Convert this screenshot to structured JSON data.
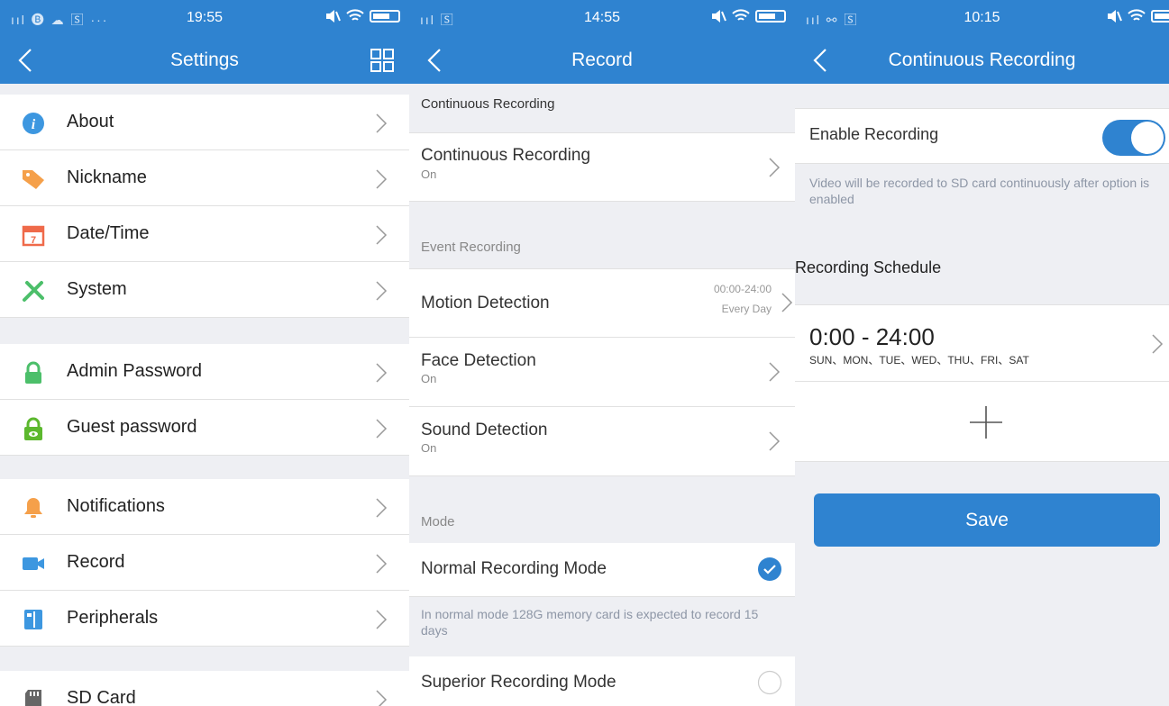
{
  "settings": {
    "status": {
      "left_icons": "ııl 🅑 ☁ 🅂 ···",
      "time": "19:55"
    },
    "title": "Settings",
    "groups": [
      [
        {
          "label": "About",
          "icon": "info-icon",
          "color": "#3d97e0"
        },
        {
          "label": "Nickname",
          "icon": "tag-icon",
          "color": "#f5a04a"
        },
        {
          "label": "Date/Time",
          "icon": "calendar-icon",
          "color": "#ef6a4a"
        },
        {
          "label": "System",
          "icon": "tools-icon",
          "color": "#4cbf6a"
        }
      ],
      [
        {
          "label": "Admin Password",
          "icon": "lock-icon",
          "color": "#4cbf6a"
        },
        {
          "label": "Guest password",
          "icon": "guest-lock-icon",
          "color": "#5cb82e"
        }
      ],
      [
        {
          "label": "Notifications",
          "icon": "bell-icon",
          "color": "#f5a04a"
        },
        {
          "label": "Record",
          "icon": "video-camera-icon",
          "color": "#3d97e0"
        },
        {
          "label": "Peripherals",
          "icon": "peripherals-icon",
          "color": "#3d97e0"
        }
      ],
      [
        {
          "label": "SD Card",
          "icon": "sd-card-icon",
          "color": "#666666"
        }
      ]
    ]
  },
  "record": {
    "status": {
      "left_icons": "ııl 🅂",
      "time": "14:55"
    },
    "title": "Record",
    "section_continuous": "Continuous Recording",
    "continuous": {
      "label": "Continuous Recording",
      "value": "On"
    },
    "section_event": "Event Recording",
    "motion": {
      "label": "Motion Detection",
      "time": "00:00-24:00",
      "days": "Every Day"
    },
    "face": {
      "label": "Face Detection",
      "value": "On"
    },
    "sound": {
      "label": "Sound Detection",
      "value": "On"
    },
    "section_mode": "Mode",
    "normal_mode": {
      "label": "Normal Recording Mode",
      "checked": true
    },
    "normal_note": "In normal mode 128G memory card is expected to record 15 days",
    "superior_mode": {
      "label": "Superior Recording Mode",
      "checked": false
    }
  },
  "continuous": {
    "status": {
      "left_icons": "ııl ⚯ 🅂",
      "time": "10:15"
    },
    "title": "Continuous Recording",
    "enable_label": "Enable Recording",
    "enabled": true,
    "enable_note": "Video will be recorded to SD card continuously after option is enabled",
    "schedule_title": "Recording Schedule",
    "schedule": {
      "time": "0:00 - 24:00",
      "days": "SUN、MON、TUE、WED、THU、FRI、SAT"
    },
    "add_label": "+",
    "save_label": "Save"
  },
  "colors": {
    "accent": "#2f83d0",
    "background": "#eeeff3"
  }
}
